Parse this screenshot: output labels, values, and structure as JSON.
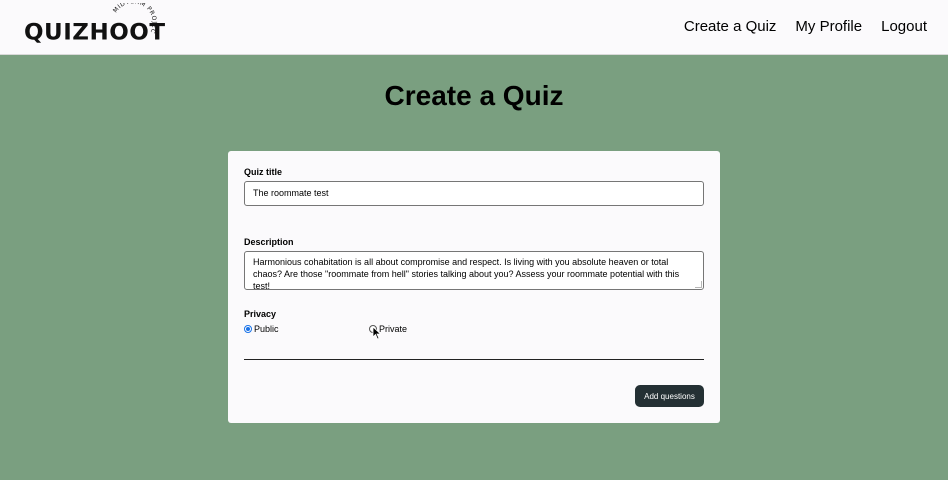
{
  "nav": {
    "logo_text": "QUIZHOOT",
    "logo_ring_text": "MIDTERM PROJECT",
    "links": [
      "Create a Quiz",
      "My Profile",
      "Logout"
    ]
  },
  "page": {
    "title": "Create a Quiz"
  },
  "form": {
    "title_label": "Quiz title",
    "title_value": "The roommate test",
    "description_label": "Description",
    "description_value": "Harmonious cohabitation is all about compromise and respect. Is living with you absolute heaven or total chaos? Are those \"roommate from hell\" stories talking about you? Assess your roommate potential with this test!",
    "privacy_label": "Privacy",
    "privacy_options": [
      {
        "label": "Public",
        "checked": true
      },
      {
        "label": "Private",
        "checked": false
      }
    ],
    "submit_label": "Add questions"
  },
  "colors": {
    "background": "#7a9f80",
    "navbar": "#fbfafc",
    "button": "#243034",
    "radio_accent": "#1a73e8"
  }
}
